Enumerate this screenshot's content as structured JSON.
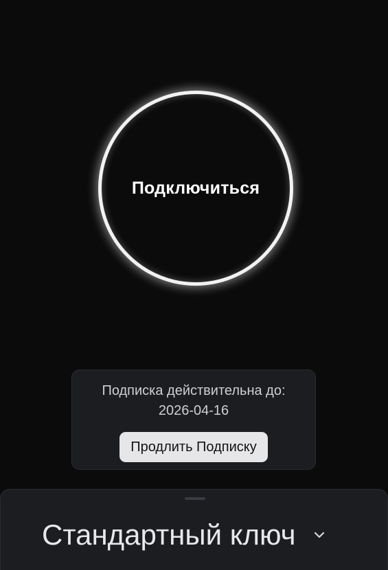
{
  "connect": {
    "label": "Подключиться"
  },
  "subscription": {
    "valid_until_label": "Подписка действительна до:",
    "expiry_date": "2026-04-16",
    "renew_label": "Продлить Подписку"
  },
  "key_selector": {
    "selected": "Стандартный ключ",
    "icon": "chevron-down-icon"
  },
  "colors": {
    "background": "#0b0b0c",
    "card": "#1c1d20",
    "ring": "#f2f2f2",
    "button": "#e6e6e8"
  }
}
